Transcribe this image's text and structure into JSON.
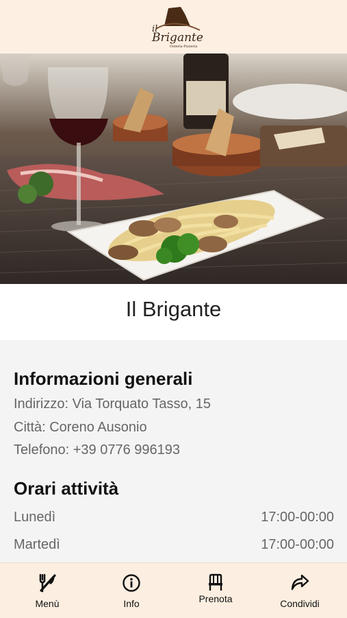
{
  "header": {
    "logo": {
      "line1": "il",
      "line2": "Brigante",
      "tagline": "Osteria-Pizzeria"
    }
  },
  "restaurant": {
    "name": "Il Brigante"
  },
  "general_info": {
    "title": "Informazioni generali",
    "address": "Indirizzo: Via Torquato Tasso, 15",
    "city": "Città: Coreno Ausonio",
    "phone": "Telefono: +39 0776 996193"
  },
  "hours": {
    "title": "Orari attività",
    "rows": [
      {
        "day": "Lunedì",
        "time": "17:00-00:00"
      },
      {
        "day": "Martedì",
        "time": "17:00-00:00"
      }
    ]
  },
  "bottom_nav": {
    "items": [
      {
        "label": "Menù",
        "icon": "fork-knife-icon"
      },
      {
        "label": "Info",
        "icon": "info-icon"
      },
      {
        "label": "Prenota",
        "icon": "chair-icon"
      },
      {
        "label": "Condividi",
        "icon": "share-icon"
      }
    ]
  },
  "colors": {
    "header_bg": "#fdf0e3",
    "panel_bg": "#f4f4f4",
    "nav_bg": "#fcefe1",
    "logo_brown": "#5a3a22"
  }
}
